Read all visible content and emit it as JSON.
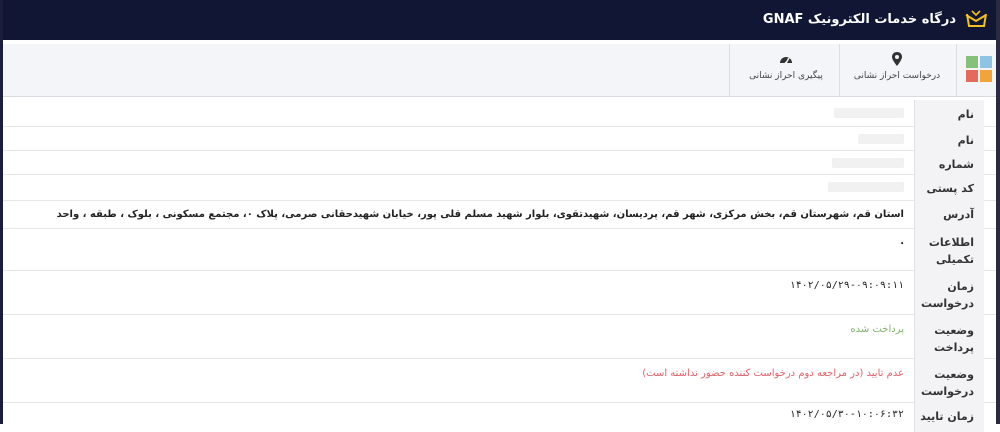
{
  "header": {
    "title": "درگاه خدمات الکترونیک GNAF",
    "logo_icon": "gnaf-envelope-logo"
  },
  "toolbar": {
    "apps_icon": "apps-grid-icon",
    "items": [
      {
        "label": "درخواست احراز نشانی",
        "icon": "map-pin-icon"
      },
      {
        "label": "پیگیری احراز نشانی",
        "icon": "dashboard-gauge-icon"
      }
    ]
  },
  "fields": [
    {
      "label": "نام",
      "value": ""
    },
    {
      "label": "نام خانوادگی",
      "value": ""
    },
    {
      "label": "شماره ملی",
      "value": ""
    },
    {
      "label": "کد پستی",
      "value": ""
    },
    {
      "label": "آدرس",
      "value": "استان قم، شهرستان قم، بخش مرکزی، شهر قم، پردیسان، شهیدتقوی، بلوار شهید مسلم قلی پور، خیابان شهیدحقانی صرمی، پلاک ۰، مجتمع مسکونی ، بلوک ، طبقه ، واحد"
    },
    {
      "label": "اطلاعات تکمیلی",
      "value": "."
    },
    {
      "label": "زمان درخواست",
      "value": "۱۴۰۲/۰۵/۲۹-۰۹:۰۹:۱۱"
    },
    {
      "label": "وضعیت پرداخت",
      "value": "پرداخت شده"
    },
    {
      "label": "وضعیت درخواست",
      "value": "عدم تایید (در مراجعه دوم درخواست کننده حضور نداشته است)"
    },
    {
      "label": "زمان تایید",
      "value": "۱۴۰۲/۰۵/۳۰-۱۰:۰۶:۳۲"
    }
  ],
  "colors": {
    "header_bg": "#101634",
    "paid_green": "#7fb36b",
    "rejected_red": "#e2616a"
  }
}
